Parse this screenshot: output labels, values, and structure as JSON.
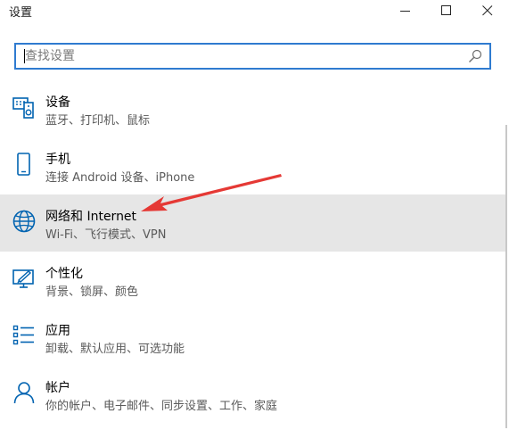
{
  "window": {
    "title": "设置",
    "minimize_icon": "minimize-icon",
    "maximize_icon": "maximize-icon",
    "close_icon": "close-icon"
  },
  "search": {
    "placeholder": "查找设置",
    "value": "",
    "icon": "search-icon"
  },
  "categories": [
    {
      "title": "设备",
      "subtitle": "蓝牙、打印机、鼠标",
      "icon": "devices-icon",
      "selected": false
    },
    {
      "title": "手机",
      "subtitle": "连接 Android 设备、iPhone",
      "icon": "phone-icon",
      "selected": false
    },
    {
      "title": "网络和 Internet",
      "subtitle": "Wi-Fi、飞行模式、VPN",
      "icon": "globe-icon",
      "selected": true
    },
    {
      "title": "个性化",
      "subtitle": "背景、锁屏、颜色",
      "icon": "personalization-icon",
      "selected": false
    },
    {
      "title": "应用",
      "subtitle": "卸载、默认应用、可选功能",
      "icon": "apps-icon",
      "selected": false
    },
    {
      "title": "帐户",
      "subtitle": "你的帐户、电子邮件、同步设置、工作、家庭",
      "icon": "account-icon",
      "selected": false
    }
  ],
  "colors": {
    "accent": "#2f7bd0",
    "icon": "#0063b1",
    "selected_bg": "#e6e6e6",
    "annotation_arrow": "#e53935"
  }
}
